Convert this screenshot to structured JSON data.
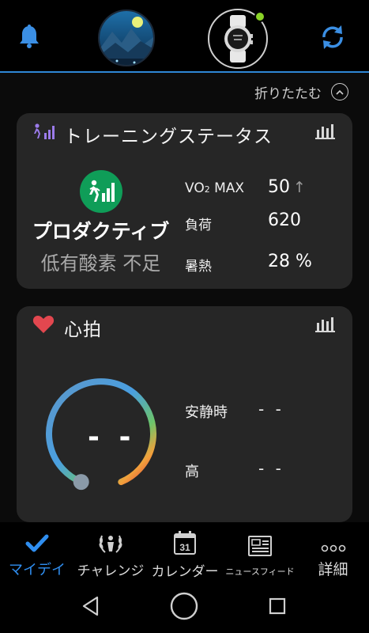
{
  "header": {
    "notifications_icon": "bell-icon",
    "profile_icon": "avatar",
    "device_icon": "watch-icon",
    "sync_icon": "sync-icon",
    "accent": "#2f87d6",
    "device_status_color": "#8ad327"
  },
  "collapse": {
    "label": "折りたたむ",
    "icon": "chevron-up-icon"
  },
  "training_status": {
    "title": "トレーニングステータス",
    "icon": "runner-chart-icon",
    "status": "プロダクティブ",
    "sub_status": "低有酸素 不足",
    "status_color": "#0f9d58",
    "metrics": {
      "vo2_label_prefix": "VO",
      "vo2_label_sub": "2",
      "vo2_label_suffix": " MAX",
      "vo2_value": "50",
      "vo2_trend": "↑",
      "load_label": "負荷",
      "load_value": "620",
      "heat_label": "暑熱",
      "heat_value": "28 %"
    }
  },
  "heart_rate": {
    "title": "心拍",
    "icon": "heart-icon",
    "current": "- -",
    "resting_label": "安静時",
    "resting_value": "- -",
    "high_label": "高",
    "high_value": "- -",
    "heart_color": "#e2474f"
  },
  "bottom_nav": {
    "items": [
      {
        "label": "マイデイ",
        "icon": "checkmark-icon",
        "active": true
      },
      {
        "label": "チャレンジ",
        "icon": "laurel-icon",
        "active": false
      },
      {
        "label": "カレンダー",
        "icon": "calendar-icon",
        "calendar_day": "31",
        "active": false
      },
      {
        "label": "ニュースフィード",
        "icon": "newsfeed-icon",
        "active": false
      },
      {
        "label": "詳細",
        "icon": "more-icon",
        "active": false
      }
    ]
  },
  "system_nav": {
    "back": "back-icon",
    "home": "home-icon",
    "recents": "recents-icon"
  }
}
